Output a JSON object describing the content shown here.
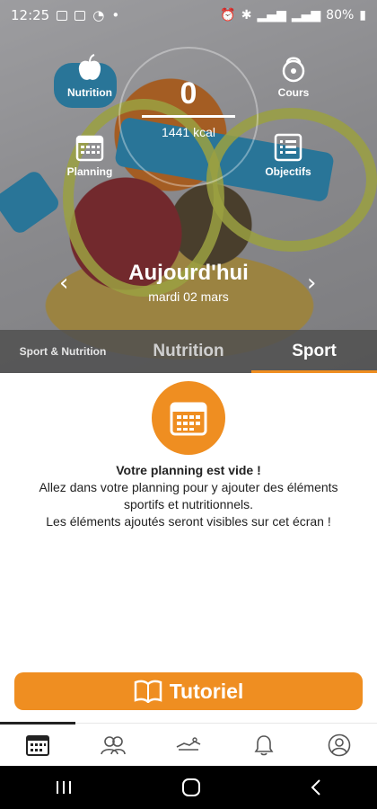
{
  "status_bar": {
    "time": "12:25",
    "battery": "80%"
  },
  "hero": {
    "tiles": {
      "nutrition": "Nutrition",
      "cours": "Cours",
      "planning": "Planning",
      "objectifs": "Objectifs"
    },
    "counter_value": "0",
    "calories": "1441 kcal",
    "day_title": "Aujourd'hui",
    "date": "mardi 02 mars"
  },
  "tabs": [
    {
      "label": "Sport & Nutrition"
    },
    {
      "label": "Nutrition"
    },
    {
      "label": "Sport",
      "active": true
    }
  ],
  "empty_state": {
    "title": "Votre planning est vide !",
    "line1": "Allez dans votre planning pour y ajouter des éléments",
    "line2": "sportifs et nutritionnels.",
    "line3": "Les éléments ajoutés seront visibles sur cet écran !"
  },
  "tutorial_button": {
    "label": "Tutoriel"
  },
  "colors": {
    "accent": "#ef8e21",
    "tab_bar": "#505050"
  },
  "icons": {
    "nutrition": "apple-icon",
    "cours": "kettlebell-icon",
    "planning": "calendar-icon",
    "objectifs": "checklist-icon",
    "bottom_nav": [
      "calendar-icon",
      "community-icon",
      "workout-icon",
      "bell-icon",
      "profile-icon"
    ]
  }
}
